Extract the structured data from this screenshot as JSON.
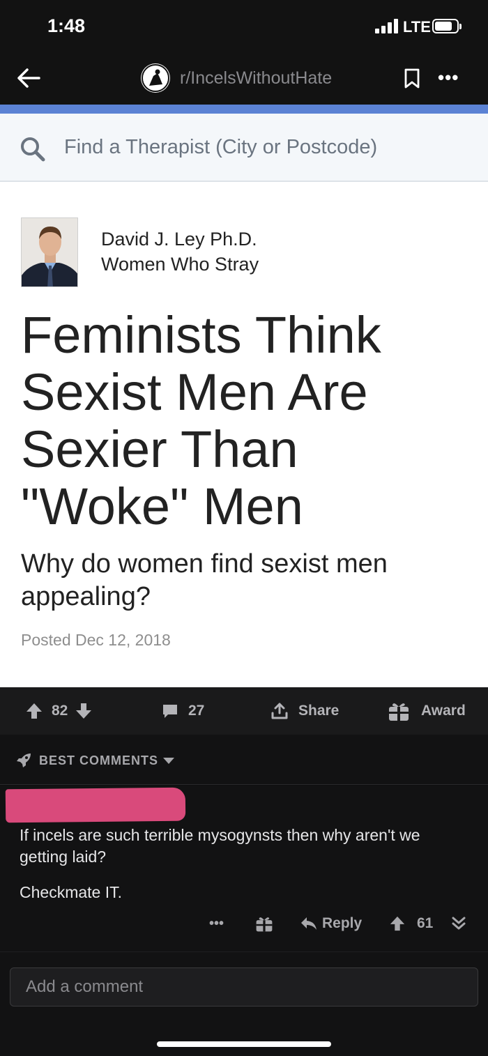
{
  "status_bar": {
    "time": "1:48",
    "network": "LTE"
  },
  "nav": {
    "subreddit": "r/IncelsWithoutHate"
  },
  "article": {
    "search_placeholder": "Find a Therapist (City or Postcode)",
    "author": "David J. Ley Ph.D.",
    "blog": "Women Who Stray",
    "headline": "Feminists Think Sexist Men Are Sexier Than \"Woke\" Men",
    "subhead": "Why do women find sexist men appealing?",
    "posted": "Posted Dec 12, 2018"
  },
  "post_actions": {
    "votes": "82",
    "comments": "27",
    "share_label": "Share",
    "award_label": "Award"
  },
  "comments_header": {
    "sort_label": "BEST COMMENTS"
  },
  "comment": {
    "text": "If incels are such terrible mysogynsts then why aren't we getting laid?",
    "text2": "Checkmate IT.",
    "reply_label": "Reply",
    "votes": "61"
  },
  "compose": {
    "placeholder": "Add a comment"
  },
  "colors": {
    "accent_blue": "#5b82d4",
    "redaction_pink": "#d94a7b",
    "dark_bg": "#121213"
  }
}
